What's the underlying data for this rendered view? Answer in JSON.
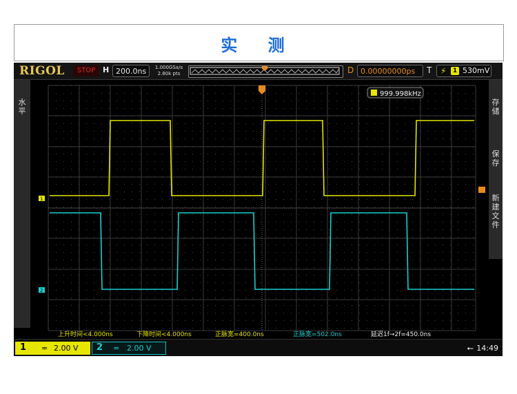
{
  "page_title": "实 测",
  "scope": {
    "brand": "RIGOL",
    "run_state": "STOP",
    "horizontal_label": "H",
    "timebase": "200.0ns",
    "sample_rate": "1.000GSa/s",
    "points": "2.80k pts",
    "delay_label": "D",
    "delay_value": "0.00000000ps",
    "trigger_label": "T",
    "trigger_level": "530mV",
    "trigger_source": "1",
    "frequency": "999.998kHz",
    "left_menu": "水平",
    "right_menu": [
      "存储",
      "保存",
      "新建文件"
    ],
    "channels": [
      {
        "id": "1",
        "coupling_symbol": "=",
        "scale": "2.00 V",
        "color": "#e6e600"
      },
      {
        "id": "2",
        "coupling_symbol": "=",
        "scale": "2.00 V",
        "color": "#1bd0d0"
      }
    ],
    "measurements": [
      "上升时间<4.000ns",
      "下降时间<4.000ns",
      "正脉宽=400.0ns",
      "正脉宽=502.0ns",
      "延迟1f→2f=450.0ns"
    ],
    "time": "14:49"
  },
  "colors": {
    "ch1": "#e6e600",
    "ch2": "#1bd0d0",
    "trigger": "#e88a20",
    "title": "#1f6fd6"
  }
}
